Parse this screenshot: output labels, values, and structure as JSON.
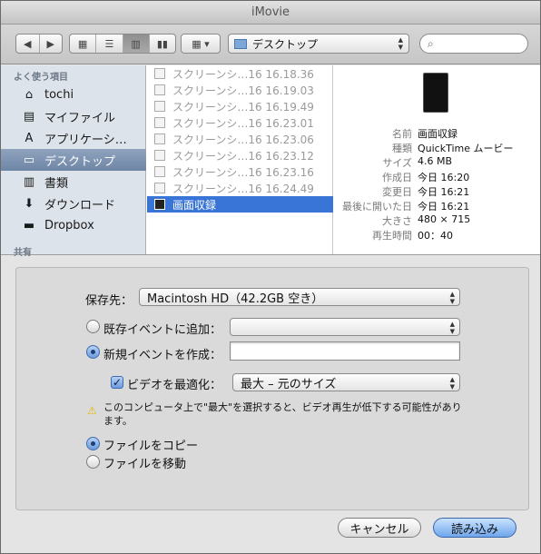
{
  "window": {
    "title": "iMovie"
  },
  "toolbar": {
    "back_icon": "chevron-left-icon",
    "forward_icon": "chevron-right-icon",
    "view_modes": [
      "icon-view-icon",
      "list-view-icon",
      "column-view-icon",
      "coverflow-view-icon"
    ],
    "arrange_icon": "arrange-grid-icon",
    "location": "デスクトップ",
    "search_placeholder": ""
  },
  "sidebar": {
    "favorites_header": "よく使う項目",
    "items": [
      {
        "label": "tochi",
        "icon": "home-icon"
      },
      {
        "label": "マイファイル",
        "icon": "all-files-icon"
      },
      {
        "label": "アプリケーシ…",
        "icon": "applications-icon"
      },
      {
        "label": "デスクトップ",
        "icon": "desktop-icon",
        "selected": true
      },
      {
        "label": "書類",
        "icon": "documents-icon"
      },
      {
        "label": "ダウンロード",
        "icon": "downloads-icon"
      },
      {
        "label": "Dropbox",
        "icon": "folder-icon"
      }
    ],
    "shared_header": "共有"
  },
  "files": [
    {
      "name": "スクリーンシ…16 16.18.36",
      "selected": false
    },
    {
      "name": "スクリーンシ…16 16.19.03",
      "selected": false
    },
    {
      "name": "スクリーンシ…16 16.19.49",
      "selected": false
    },
    {
      "name": "スクリーンシ…16 16.23.01",
      "selected": false
    },
    {
      "name": "スクリーンシ…16 16.23.06",
      "selected": false
    },
    {
      "name": "スクリーンシ…16 16.23.12",
      "selected": false
    },
    {
      "name": "スクリーンシ…16 16.23.16",
      "selected": false
    },
    {
      "name": "スクリーンシ…16 16.24.49",
      "selected": false
    },
    {
      "name": "画面収録",
      "selected": true
    }
  ],
  "preview": {
    "info": [
      {
        "key": "名前",
        "value": "画面収録"
      },
      {
        "key": "種類",
        "value": "QuickTime ムービー"
      },
      {
        "key": "サイズ",
        "value": "4.6 MB"
      },
      {
        "key": "作成日",
        "value": "今日 16:20"
      },
      {
        "key": "変更日",
        "value": "今日 16:21"
      },
      {
        "key": "最後に開いた日",
        "value": "今日 16:21"
      },
      {
        "key": "大きさ",
        "value": "480 × 715"
      },
      {
        "key": "再生時間",
        "value": "00：40"
      }
    ]
  },
  "import_options": {
    "save_to_label": "保存先：",
    "save_to_value": "Macintosh HD（42.2GB 空き）",
    "add_existing_label": "既存イベントに追加：",
    "add_existing_value": "",
    "create_new_label": "新規イベントを作成：",
    "create_new_value": "",
    "optimize_label": "ビデオを最適化：",
    "optimize_checked": true,
    "optimize_value": "最大 – 元のサイズ",
    "warning_text": "このコンピュータ上で\"最大\"を選択すると、ビデオ再生が低下する可能性があります。",
    "copy_label": "ファイルをコピー",
    "move_label": "ファイルを移動",
    "selected_event_option": "create_new",
    "selected_file_option": "copy"
  },
  "buttons": {
    "cancel": "キャンセル",
    "import": "読み込み"
  }
}
